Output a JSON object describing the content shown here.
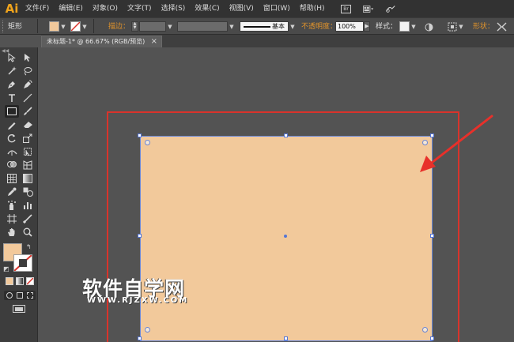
{
  "app": {
    "logo": "Ai"
  },
  "menu": [
    "文件(F)",
    "编辑(E)",
    "对象(O)",
    "文字(T)",
    "选择(S)",
    "效果(C)",
    "视图(V)",
    "窗口(W)",
    "帮助(H)"
  ],
  "menu_icons": [
    "bridge-icon",
    "arrange-documents-icon",
    "workspace-switch-icon"
  ],
  "menu_badge": "Br",
  "control_bar": {
    "selection_label": "矩形",
    "stroke_label": "描边：",
    "stroke_profile": "基本",
    "opacity_label": "不透明度：",
    "opacity_value": "100%",
    "style_label": "样式：",
    "shape_label": "形状："
  },
  "document_tab": {
    "title": "未标题-1* @ 66.67% (RGB/预览)",
    "close": "×"
  },
  "colors": {
    "accent": "#F0A41C",
    "fill": "#F2C99B",
    "artboard_border": "#D9332B",
    "selection": "#5676D4",
    "arrow": "#E8302A"
  },
  "watermark": {
    "title": "软件自学网",
    "url": "WWW.RJZXW.COM"
  }
}
